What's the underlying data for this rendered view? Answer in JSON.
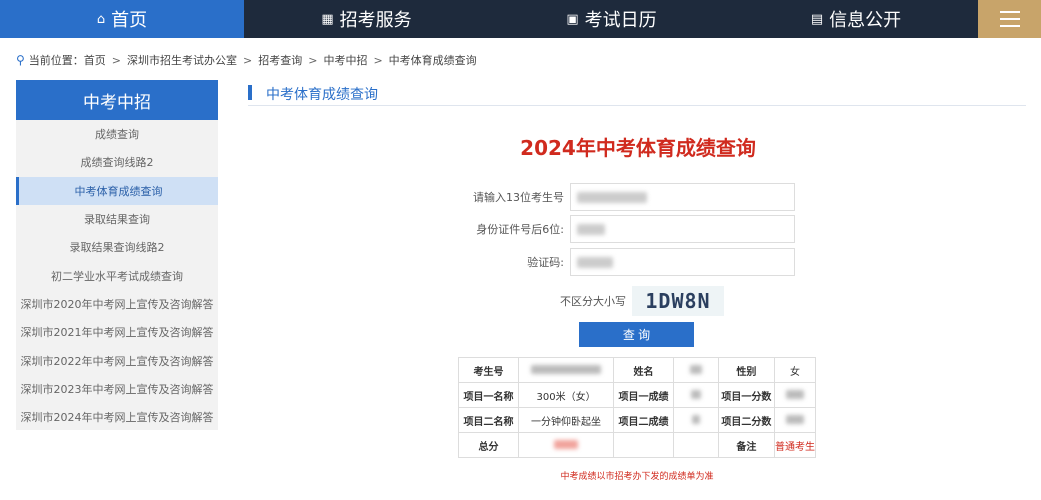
{
  "nav": {
    "home": "首页",
    "items": [
      "招考服务",
      "考试日历",
      "信息公开"
    ]
  },
  "breadcrumb": {
    "prefix": "当前位置：",
    "items": [
      "首页",
      "深圳市招生考试办公室",
      "招考查询",
      "中考中招",
      "中考体育成绩查询"
    ]
  },
  "sidebar": {
    "title": "中考中招",
    "items": [
      {
        "label": "成绩查询",
        "active": false
      },
      {
        "label": "成绩查询线路2",
        "active": false
      },
      {
        "label": "中考体育成绩查询",
        "active": true
      },
      {
        "label": "录取结果查询",
        "active": false
      },
      {
        "label": "录取结果查询线路2",
        "active": false
      },
      {
        "label": "初二学业水平考试成绩查询",
        "active": false
      },
      {
        "label": "深圳市2020年中考网上宣传及咨询解答",
        "active": false
      },
      {
        "label": "深圳市2021年中考网上宣传及咨询解答",
        "active": false
      },
      {
        "label": "深圳市2022年中考网上宣传及咨询解答",
        "active": false
      },
      {
        "label": "深圳市2023年中考网上宣传及咨询解答",
        "active": false
      },
      {
        "label": "深圳市2024年中考网上宣传及咨询解答",
        "active": false
      }
    ]
  },
  "main": {
    "section_title": "中考体育成绩查询",
    "page_title": "2024年中考体育成绩查询",
    "form": {
      "exam_no_label": "请输入13位考生号",
      "id_label": "身份证件号后6位:",
      "code_label": "验证码:",
      "captcha_hint": "不区分大小写",
      "captcha_text": "1DW8N",
      "submit_label": "查 询"
    },
    "result": {
      "exam_no_label": "考生号",
      "name_label": "姓名",
      "gender_label": "性别",
      "gender_value": "女",
      "item1_name_label": "项目一名称",
      "item1_name_value": "300米（女）",
      "item1_score_label": "项目一成绩",
      "item1_points_label": "项目一分数",
      "item2_name_label": "项目二名称",
      "item2_name_value": "一分钟仰卧起坐",
      "item2_score_label": "项目二成绩",
      "item2_points_label": "项目二分数",
      "total_label": "总分",
      "remark_label": "备注",
      "remark_value": "普通考生"
    },
    "note": "中考成绩以市招考办下发的成绩单为准"
  },
  "colors": {
    "accent": "#2a6fc9",
    "nav_bg": "#1e2a3c",
    "menu_bg": "#c8a46a",
    "title_red": "#d02a1e"
  },
  "icons": {
    "home": "home-icon",
    "services": "grid-icon",
    "calendar": "calendar-icon",
    "info": "document-icon",
    "menu": "hamburger-icon",
    "location": "location-pin-icon"
  }
}
